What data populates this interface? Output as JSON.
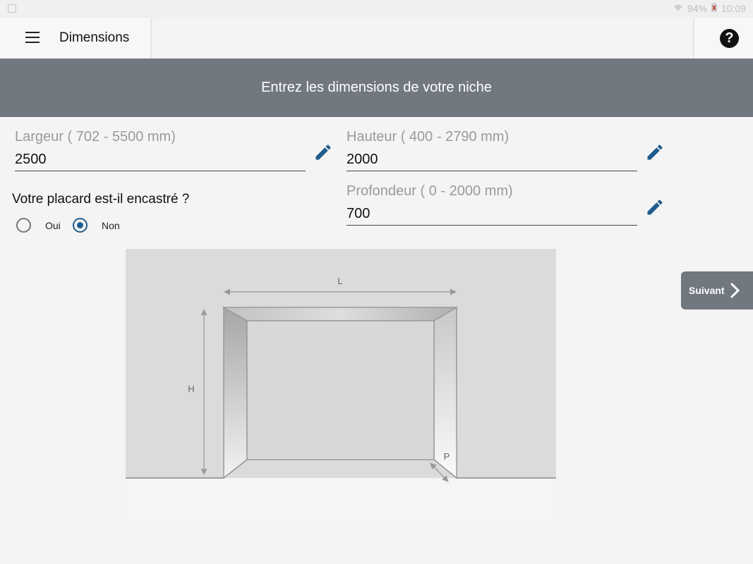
{
  "status": {
    "battery": "94%",
    "time": "10:09"
  },
  "appbar": {
    "title": "Dimensions"
  },
  "banner": {
    "text": "Entrez les dimensions de votre niche"
  },
  "fields": {
    "largeur": {
      "label": "Largeur ( 702 - 5500 mm)",
      "value": "2500"
    },
    "hauteur": {
      "label": "Hauteur ( 400 - 2790 mm)",
      "value": "2000"
    },
    "profondeur": {
      "label": "Profondeur ( 0 - 2000 mm)",
      "value": "700"
    }
  },
  "encastre": {
    "question": "Votre placard est-il encastré ?",
    "options": [
      {
        "label": "Oui",
        "selected": false
      },
      {
        "label": "Non",
        "selected": true
      }
    ]
  },
  "diagram": {
    "label_l": "L",
    "label_h": "H",
    "label_p": "P"
  },
  "next": {
    "label": "Suivant"
  },
  "colors": {
    "banner": "#727880",
    "accent": "#1f5b8c",
    "edit_icon": "#1f5b8c"
  },
  "icons": [
    "menu-icon",
    "help-icon",
    "pencil-icon",
    "chevron-right-icon"
  ]
}
